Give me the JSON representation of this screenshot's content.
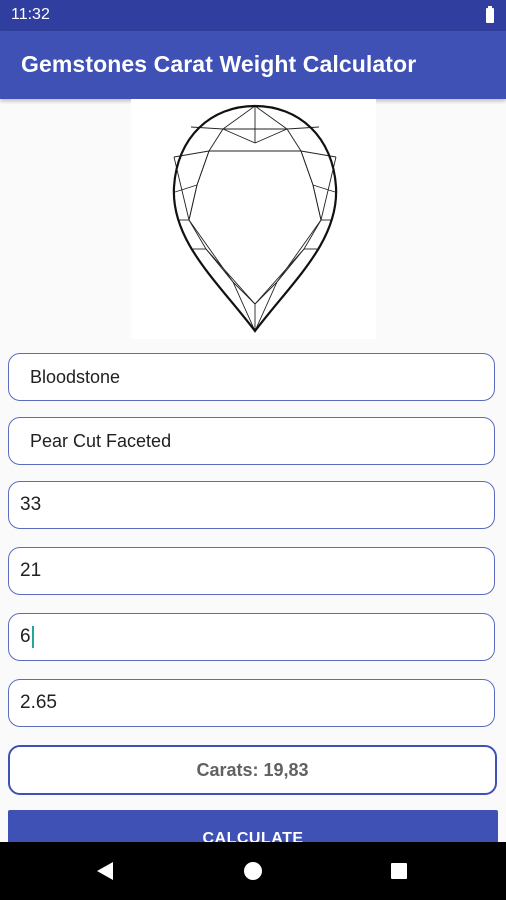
{
  "status_bar": {
    "time": "11:32"
  },
  "app_bar": {
    "title": "Gemstones Carat Weight Calculator"
  },
  "fields": {
    "gemstone": "Bloodstone",
    "cut": "Pear Cut Faceted",
    "length": "33",
    "width": "21",
    "depth": "6",
    "specific_gravity": "2.65"
  },
  "result": {
    "text": "Carats: 19,83"
  },
  "calculate_button": {
    "label": "CALCULATE"
  },
  "icons": {
    "battery": "battery-icon",
    "back": "back-icon",
    "home": "home-icon",
    "recents": "recents-icon"
  },
  "colors": {
    "primary": "#3f51b5",
    "primary_dark": "#303f9f",
    "cursor": "#26a69a"
  }
}
